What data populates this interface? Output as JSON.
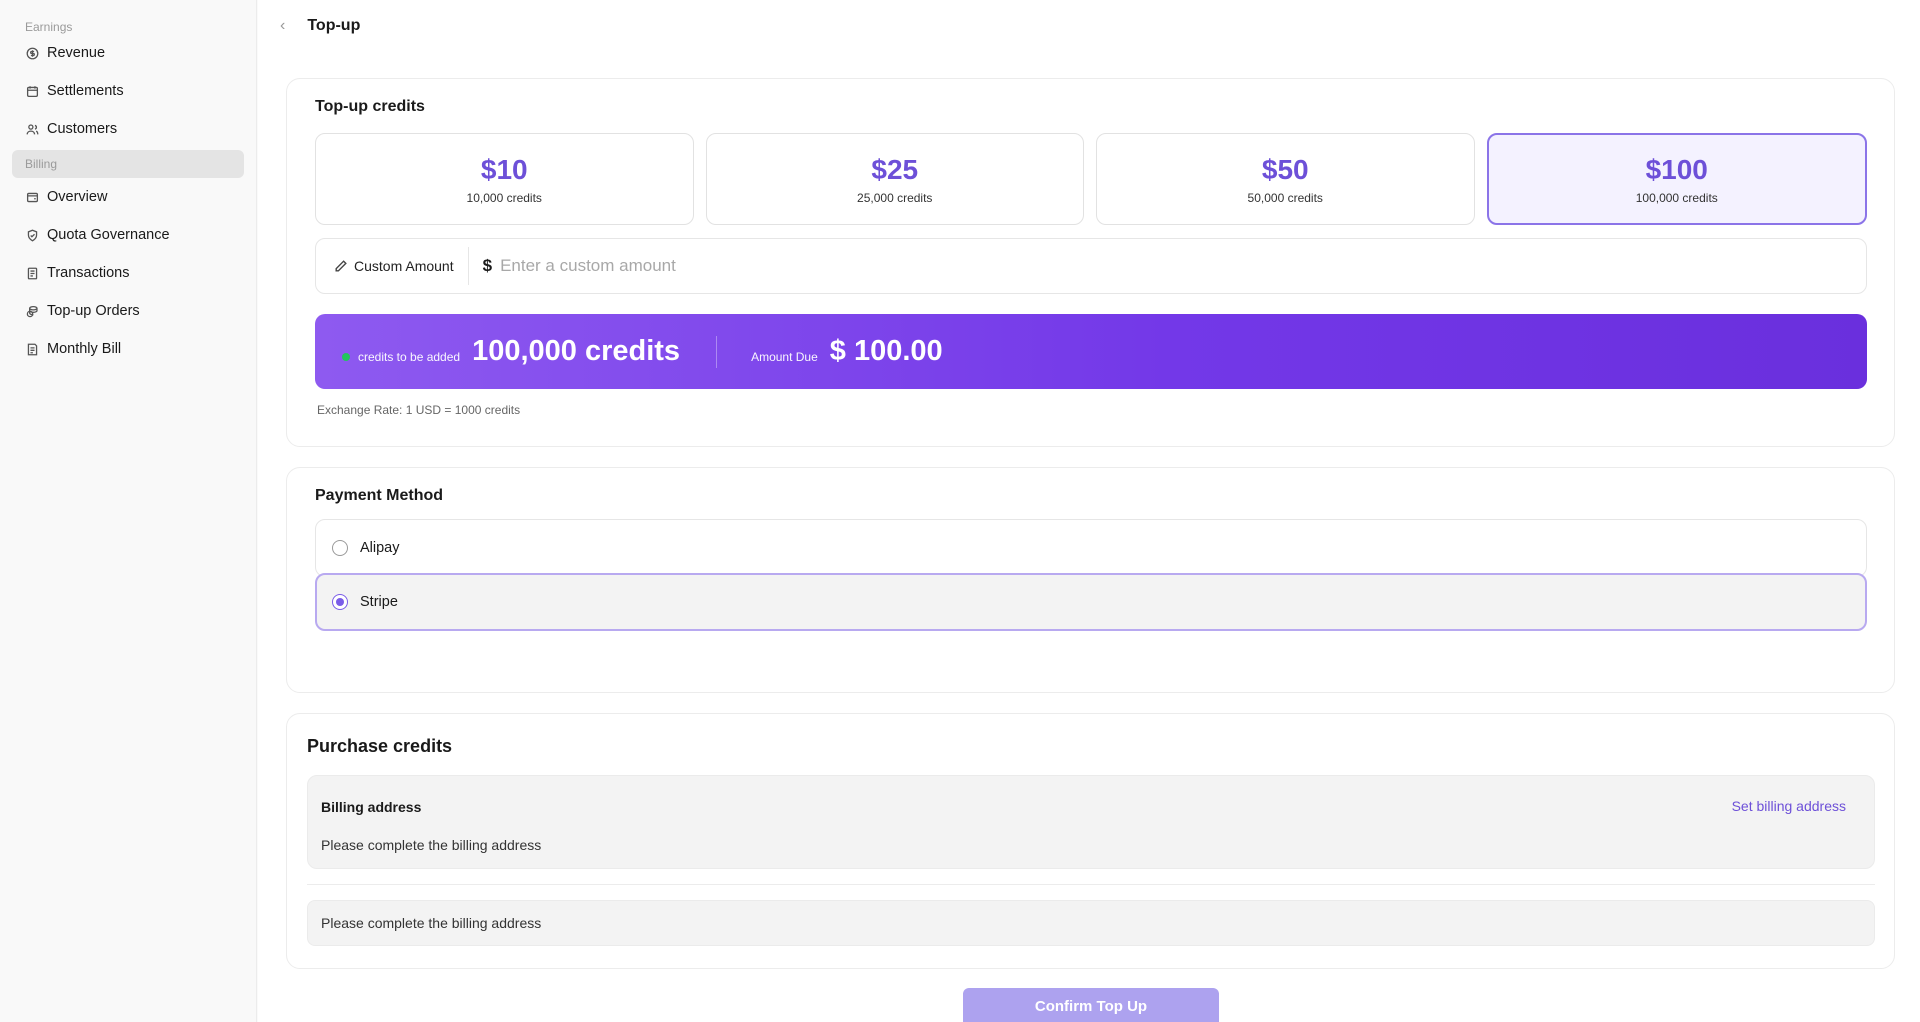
{
  "sidebar": {
    "section_earnings": "Earnings",
    "earnings_items": [
      {
        "label": "Revenue",
        "icon": "dollar-circle-icon"
      },
      {
        "label": "Settlements",
        "icon": "calendar-icon"
      },
      {
        "label": "Customers",
        "icon": "users-icon"
      }
    ],
    "section_billing": "Billing",
    "billing_items": [
      {
        "label": "Overview",
        "icon": "wallet-icon"
      },
      {
        "label": "Quota Governance",
        "icon": "shield-icon"
      },
      {
        "label": "Transactions",
        "icon": "receipt-icon"
      },
      {
        "label": "Top-up Orders",
        "icon": "coins-icon"
      },
      {
        "label": "Monthly Bill",
        "icon": "bill-icon"
      }
    ]
  },
  "header": {
    "back_icon": "chevron-left-icon",
    "title": "Top-up"
  },
  "topup": {
    "title": "Top-up credits",
    "presets": [
      {
        "amount": "$10",
        "credits": "10,000 credits",
        "selected": false
      },
      {
        "amount": "$25",
        "credits": "25,000 credits",
        "selected": false
      },
      {
        "amount": "$50",
        "credits": "50,000 credits",
        "selected": false
      },
      {
        "amount": "$100",
        "credits": "100,000 credits",
        "selected": true
      }
    ],
    "custom_label": "Custom Amount",
    "custom_icon": "pencil-icon",
    "currency_symbol": "$",
    "custom_placeholder": "Enter a custom amount",
    "credits_label": "credits to be added",
    "credits_value": "100,000 credits",
    "amount_due_label": "Amount Due",
    "amount_due_value": "$ 100.00",
    "exchange_rate": "Exchange Rate: 1 USD = 1000 credits",
    "accent_color": "#6d50d8",
    "status_dot_color": "#22c55e"
  },
  "payment": {
    "title": "Payment Method",
    "options": [
      {
        "label": "Alipay",
        "selected": false
      },
      {
        "label": "Stripe",
        "selected": true
      }
    ]
  },
  "purchase": {
    "title": "Purchase credits",
    "billing_title": "Billing address",
    "set_link": "Set billing address",
    "billing_message": "Please complete the billing address",
    "footer_message": "Please complete the billing address"
  },
  "confirm_button": "Confirm Top Up"
}
